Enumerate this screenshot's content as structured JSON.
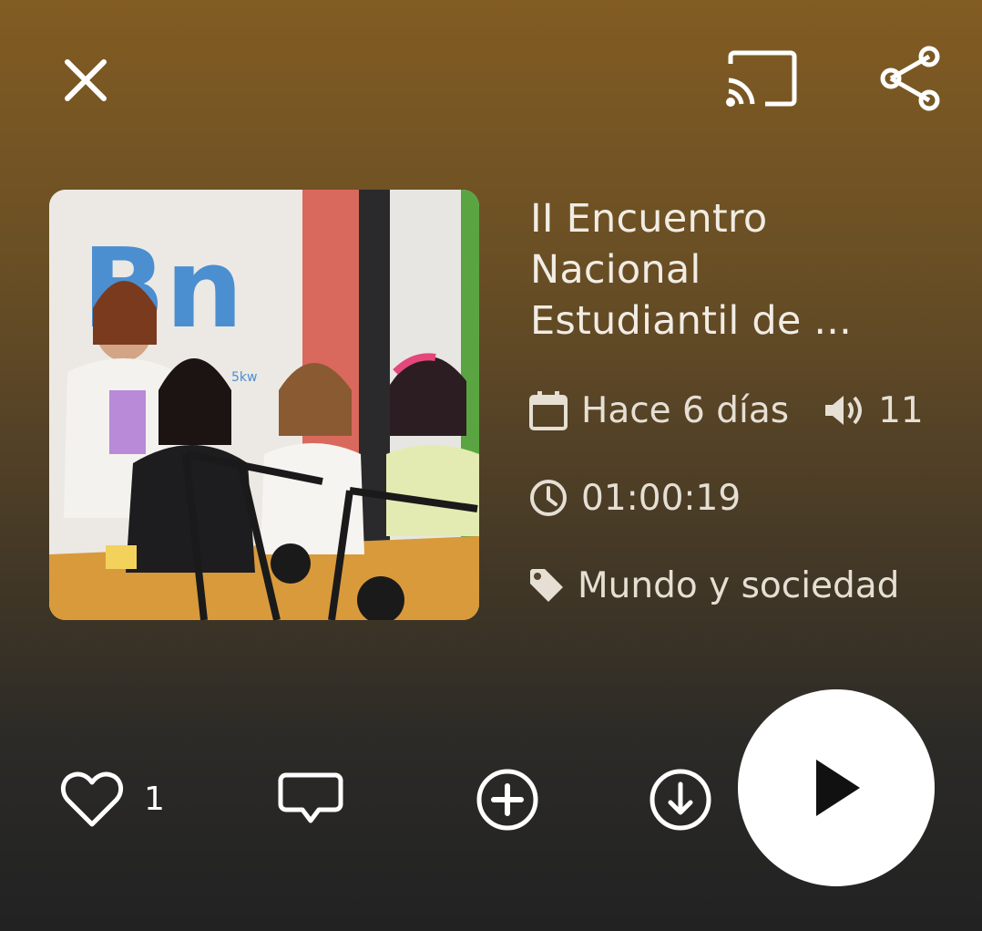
{
  "episode": {
    "title_lines": [
      "II Encuentro",
      "Nacional",
      "Estudiantil de ..."
    ],
    "published": "Hace 6 días",
    "plays": "11",
    "duration": "01:00:19",
    "category": "Mundo y sociedad",
    "likes": "1"
  },
  "cover": {
    "logo_letters": "Bn",
    "logo_power": "5kw"
  },
  "icons": {
    "close": "close-icon",
    "cast": "cast-icon",
    "share": "share-icon",
    "date": "calendar-icon",
    "plays": "volume-icon",
    "duration": "clock-icon",
    "category": "tag-icon",
    "like": "heart-icon",
    "comment": "comment-icon",
    "add": "plus-circle-icon",
    "download": "download-circle-icon",
    "play": "play-icon"
  },
  "colors": {
    "background_top": "#825c22",
    "background_bottom": "#222223",
    "text": "#f1ece4",
    "play_button": "#ffffff"
  }
}
